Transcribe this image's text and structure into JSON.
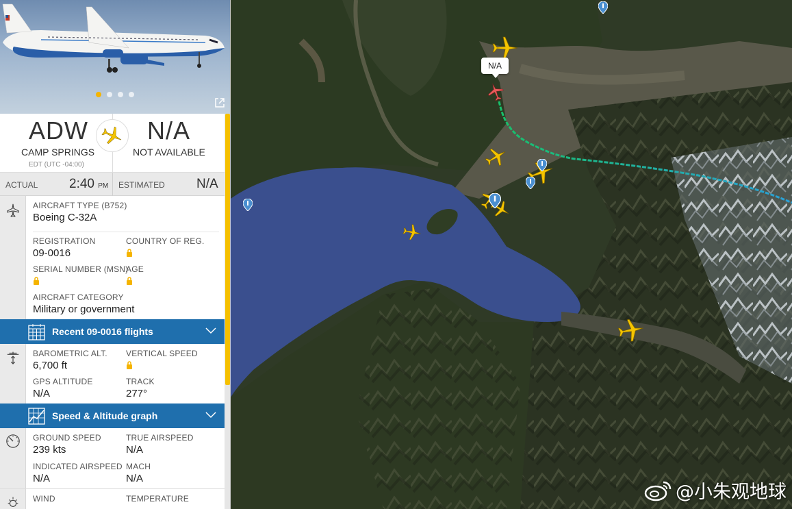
{
  "panel": {
    "photo": {
      "dot_count": 4,
      "active_dot": 0,
      "accent": "#f5b400"
    },
    "origin": {
      "code": "ADW",
      "city": "CAMP SPRINGS",
      "timezone": "EDT (UTC -04:00)"
    },
    "destination": {
      "code": "N/A",
      "city": "NOT AVAILABLE"
    },
    "times": {
      "actual_label": "ACTUAL",
      "actual_value": "2:40",
      "actual_suffix": "PM",
      "estimated_label": "ESTIMATED",
      "estimated_value": "N/A"
    },
    "aircraft": {
      "type_label": "AIRCRAFT TYPE",
      "type_code": "(B752)",
      "type_value": "Boeing C-32A",
      "registration_label": "REGISTRATION",
      "registration_value": "09-0016",
      "country_label": "COUNTRY OF REG.",
      "msn_label": "SERIAL NUMBER (MSN)",
      "age_label": "AGE",
      "category_label": "AIRCRAFT CATEGORY",
      "category_value": "Military or government"
    },
    "recent_flights_bar": {
      "label": "Recent 09-0016 flights"
    },
    "altitude": {
      "baro_label": "BAROMETRIC ALT.",
      "baro_value": "6,700 ft",
      "vs_label": "VERTICAL SPEED",
      "gps_label": "GPS ALTITUDE",
      "gps_value": "N/A",
      "track_label": "TRACK",
      "track_value": "277°"
    },
    "graph_bar": {
      "label": "Speed & Altitude graph"
    },
    "speed": {
      "gs_label": "GROUND SPEED",
      "gs_value": "239 kts",
      "tas_label": "TRUE AIRSPEED",
      "tas_value": "N/A",
      "ias_label": "INDICATED AIRSPEED",
      "ias_value": "N/A",
      "mach_label": "MACH",
      "mach_value": "N/A"
    },
    "weather": {
      "wind_label": "WIND",
      "temp_label": "TEMPERATURE"
    }
  },
  "map": {
    "selected_label": "N/A",
    "watermark": "@小朱观地球",
    "colors": {
      "water": "#3a4f8e",
      "plane": "#f5c400",
      "selected_plane": "#e85a5a",
      "track_start": "#18c06a",
      "track_end": "#2aa0d8",
      "pin": "#4a8fd0"
    }
  }
}
